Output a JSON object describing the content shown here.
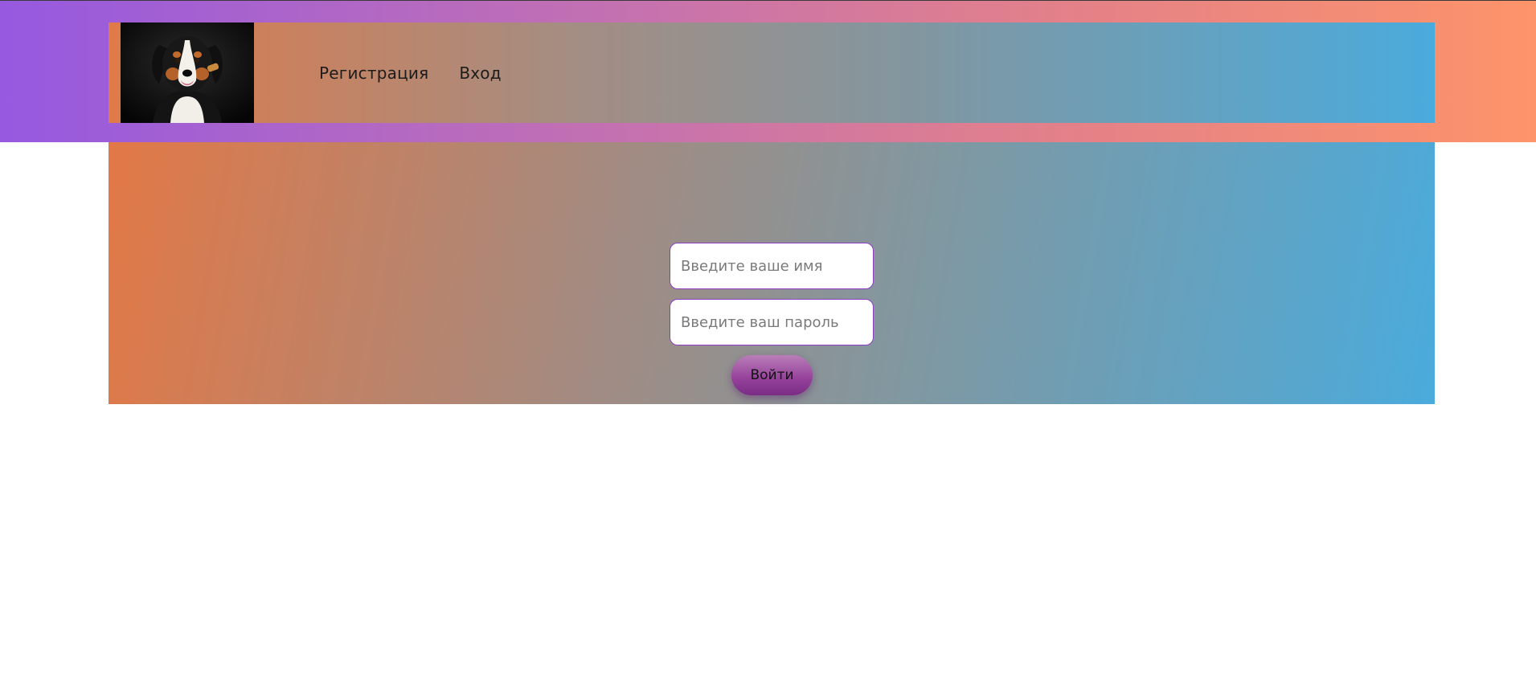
{
  "header": {
    "logo_alt": "dog photo",
    "nav": [
      {
        "label": "Регистрация"
      },
      {
        "label": "Вход"
      }
    ]
  },
  "login_form": {
    "name_placeholder": "Введите ваше имя",
    "password_placeholder": "Введите ваш пароль",
    "submit_label": "Войти"
  },
  "colors": {
    "header_gradient": [
      "#9659e0",
      "#c471b1",
      "#e48188",
      "#fd946a"
    ],
    "panel_gradient": [
      "#e27846",
      "#a28b82",
      "#82979f",
      "#4aabdc"
    ],
    "input_border": "#8b3ec2",
    "button_gradient": [
      "#b97eb8",
      "#94409a",
      "#7a2d85"
    ]
  }
}
